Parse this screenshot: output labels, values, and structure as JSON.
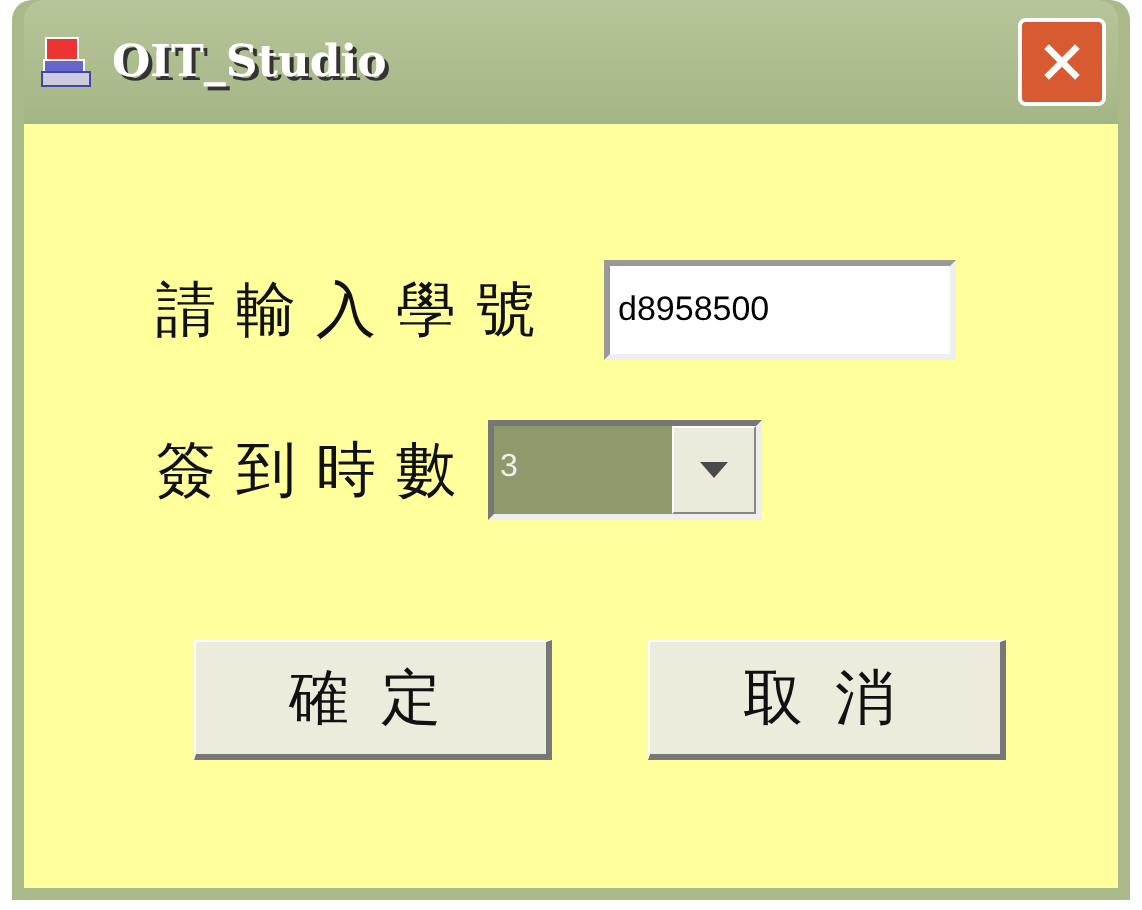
{
  "window": {
    "title": "OIT_Studio"
  },
  "fields": [
    {
      "kind": "text",
      "label": "請輸入學號",
      "value": "d8958500"
    },
    {
      "kind": "combo",
      "label": "簽到時數",
      "value": "3",
      "disabled": true
    }
  ],
  "buttons": [
    {
      "label": "確定"
    },
    {
      "label": "取消"
    }
  ]
}
